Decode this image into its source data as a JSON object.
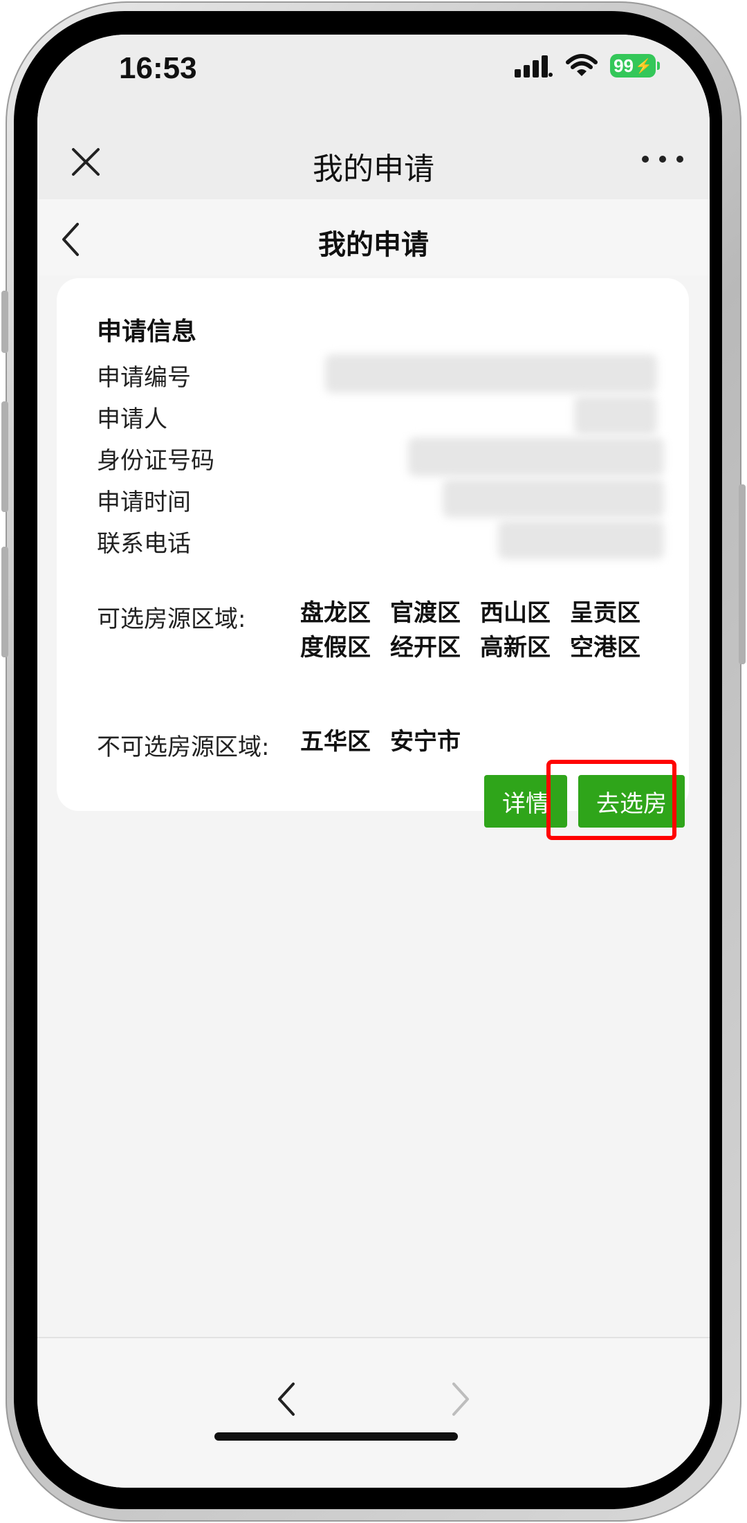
{
  "status_bar": {
    "time": "16:53",
    "battery": "99"
  },
  "wechat_bar": {
    "title": "我的申请"
  },
  "header": {
    "title": "我的申请"
  },
  "card": {
    "section_title": "申请信息",
    "fields": [
      {
        "label": "申请编号"
      },
      {
        "label": "申请人"
      },
      {
        "label": "身份证号码"
      },
      {
        "label": "申请时间"
      },
      {
        "label": "联系电话"
      }
    ],
    "available_areas_label": "可选房源区域:",
    "available_areas": [
      "盘龙区",
      "官渡区",
      "西山区",
      "呈贡区",
      "度假区",
      "经开区",
      "高新区",
      "空港区"
    ],
    "unavailable_areas_label": "不可选房源区域:",
    "unavailable_areas": [
      "五华区",
      "安宁市"
    ],
    "detail_button": "详情",
    "select_button": "去选房"
  },
  "colors": {
    "primary_green": "#2fa51a",
    "highlight_red": "#ff0000",
    "battery_green": "#34c759"
  }
}
